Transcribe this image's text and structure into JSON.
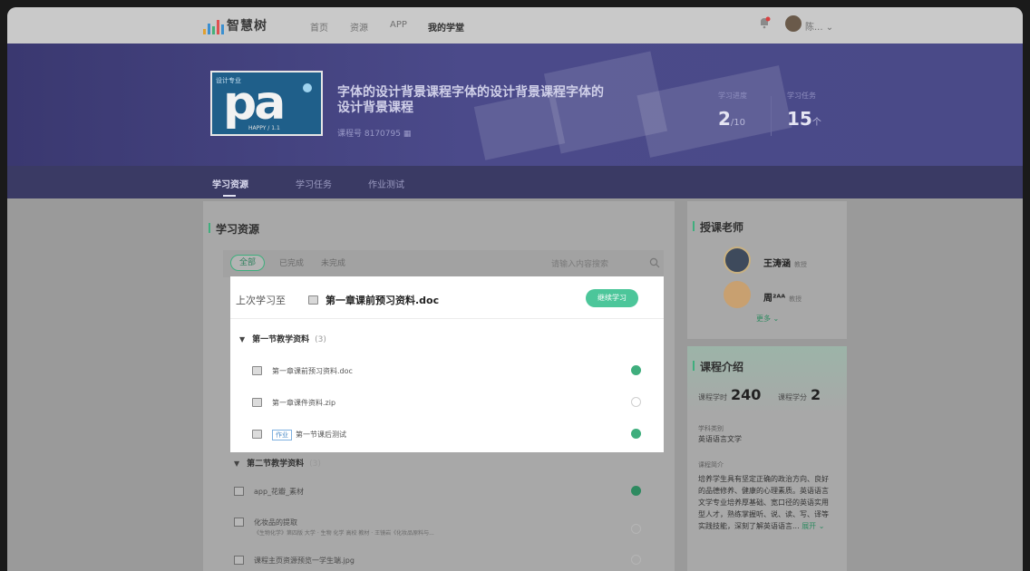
{
  "nav": {
    "logo_text": "智慧树",
    "links": [
      "首页",
      "资源",
      "APP",
      "我的学堂"
    ],
    "user_name": "陈..."
  },
  "banner": {
    "cover_tag": "设计专业",
    "cover_big": "pa",
    "cover_sub": "HAPPY / 1.1",
    "course_title": "字体的设计背景课程字体的设计背景课程字体的设计背景课程",
    "course_code": "课程号 8170795",
    "progress_label": "学习进度",
    "progress_value": "2",
    "progress_total": "/10",
    "credit_label": "学习任务",
    "credit_value": "15",
    "credit_unit": "个"
  },
  "tabs": [
    "学习资源",
    "学习任务",
    "作业测试"
  ],
  "resources": {
    "title": "学习资源",
    "filters": [
      "全部",
      "已完成",
      "未完成"
    ],
    "search_placeholder": "请输入内容搜索",
    "last_study_label": "上次学习至",
    "last_study_file": "第一章课前预习资料.doc",
    "continue_label": "继续学习",
    "chapters": [
      {
        "title": "第一节教学资料",
        "count": "(3)",
        "items": [
          {
            "name": "第一章课前预习资料.doc",
            "tag": "",
            "done": true
          },
          {
            "name": "第一章课件资料.zip",
            "tag": "",
            "done": false
          },
          {
            "name": "第一节课后测试",
            "tag": "作业",
            "done": true
          }
        ]
      },
      {
        "title": "第二节教学资料",
        "count": "(3)",
        "items": [
          {
            "name": "app_花瓣_素材",
            "sub": "",
            "done": true
          },
          {
            "name": "化妆品的提取",
            "sub": "《生物化学》第四版 大学 · 生物 化学 高校 教材 · 王镜岩《化妆品原料与...",
            "done": false
          },
          {
            "name": "课程主页资源预览一学生端.jpg",
            "sub": "",
            "done": false
          }
        ]
      }
    ]
  },
  "sidebar": {
    "teachers_title": "授课老师",
    "teachers": [
      {
        "name": "王",
        "name_tail": "涛涵",
        "title": "教授"
      },
      {
        "name": "周",
        "name_tail": "²ᴬᴬ",
        "title": "教授"
      }
    ],
    "more_label": "更多",
    "intro_title": "课程介绍",
    "hours_label": "课程学时",
    "hours_value": "240",
    "credit_label": "课程学分",
    "credit_value": "2",
    "category_label": "学科类别",
    "category_value": "英语语言文学",
    "intro_label": "课程简介",
    "intro_text": "培养学生具有坚定正确的政治方向、良好的品德修养、健康的心理素质。英语语言文学专业培养厚基础、宽口径的英语实用型人才，熟练掌握听、说、读、写、译等实践技能，深刻了解英语语言...",
    "expand_label": "展开"
  }
}
